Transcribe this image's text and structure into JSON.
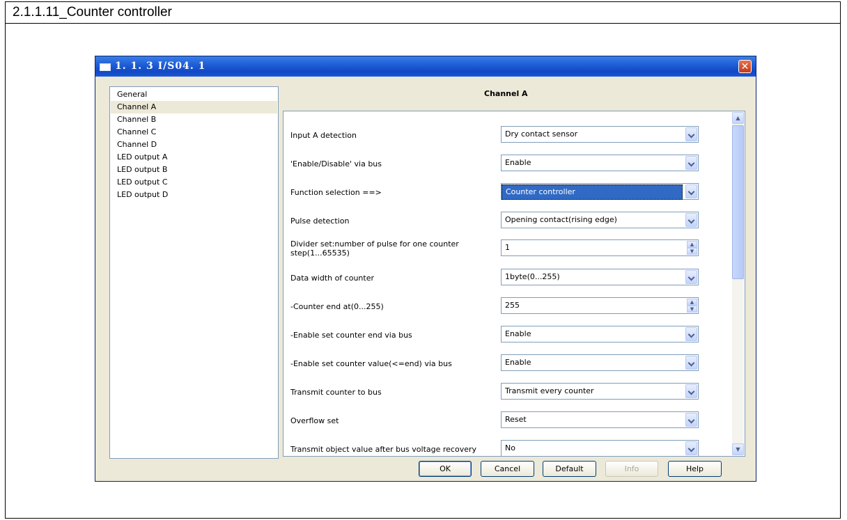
{
  "document": {
    "header": "2.1.1.11_Counter controller"
  },
  "window": {
    "title": "1. 1. 3 I/S04. 1",
    "close_glyph": "✕",
    "panel_title": "Channel A",
    "nav": [
      {
        "label": "General"
      },
      {
        "label": "Channel A"
      },
      {
        "label": "Channel B"
      },
      {
        "label": "Channel C"
      },
      {
        "label": "Channel D"
      },
      {
        "label": "LED output A"
      },
      {
        "label": "LED output B"
      },
      {
        "label": "LED output C"
      },
      {
        "label": "LED output D"
      }
    ],
    "selected_nav": "Channel A",
    "params": [
      {
        "label": "Input A detection",
        "value": "Dry contact sensor",
        "control": "dropdown"
      },
      {
        "label": "'Enable/Disable' via bus",
        "value": "Enable",
        "control": "dropdown"
      },
      {
        "label": "Function selection ==>",
        "value": "Counter controller",
        "control": "dropdown",
        "focused": true
      },
      {
        "label": "Pulse detection",
        "value": "Opening contact(rising edge)",
        "control": "dropdown"
      },
      {
        "label": "Divider set:number of pulse for one counter step(1...65535)",
        "value": "1",
        "control": "spin"
      },
      {
        "label": "Data width of counter",
        "value": "1byte(0...255)",
        "control": "dropdown"
      },
      {
        "label": "-Counter end at(0...255)",
        "value": "255",
        "control": "spin"
      },
      {
        "label": "-Enable set counter end via bus",
        "value": "Enable",
        "control": "dropdown"
      },
      {
        "label": "-Enable set counter value(<=end) via bus",
        "value": "Enable",
        "control": "dropdown"
      },
      {
        "label": "Transmit counter to bus",
        "value": "Transmit every counter",
        "control": "dropdown"
      },
      {
        "label": "Overflow set",
        "value": "Reset",
        "control": "dropdown"
      },
      {
        "label": "Transmit object value after bus voltage recovery",
        "value": "No",
        "control": "dropdown"
      }
    ],
    "buttons": {
      "ok": "OK",
      "cancel": "Cancel",
      "default": "Default",
      "info": "Info",
      "help": "Help"
    }
  }
}
